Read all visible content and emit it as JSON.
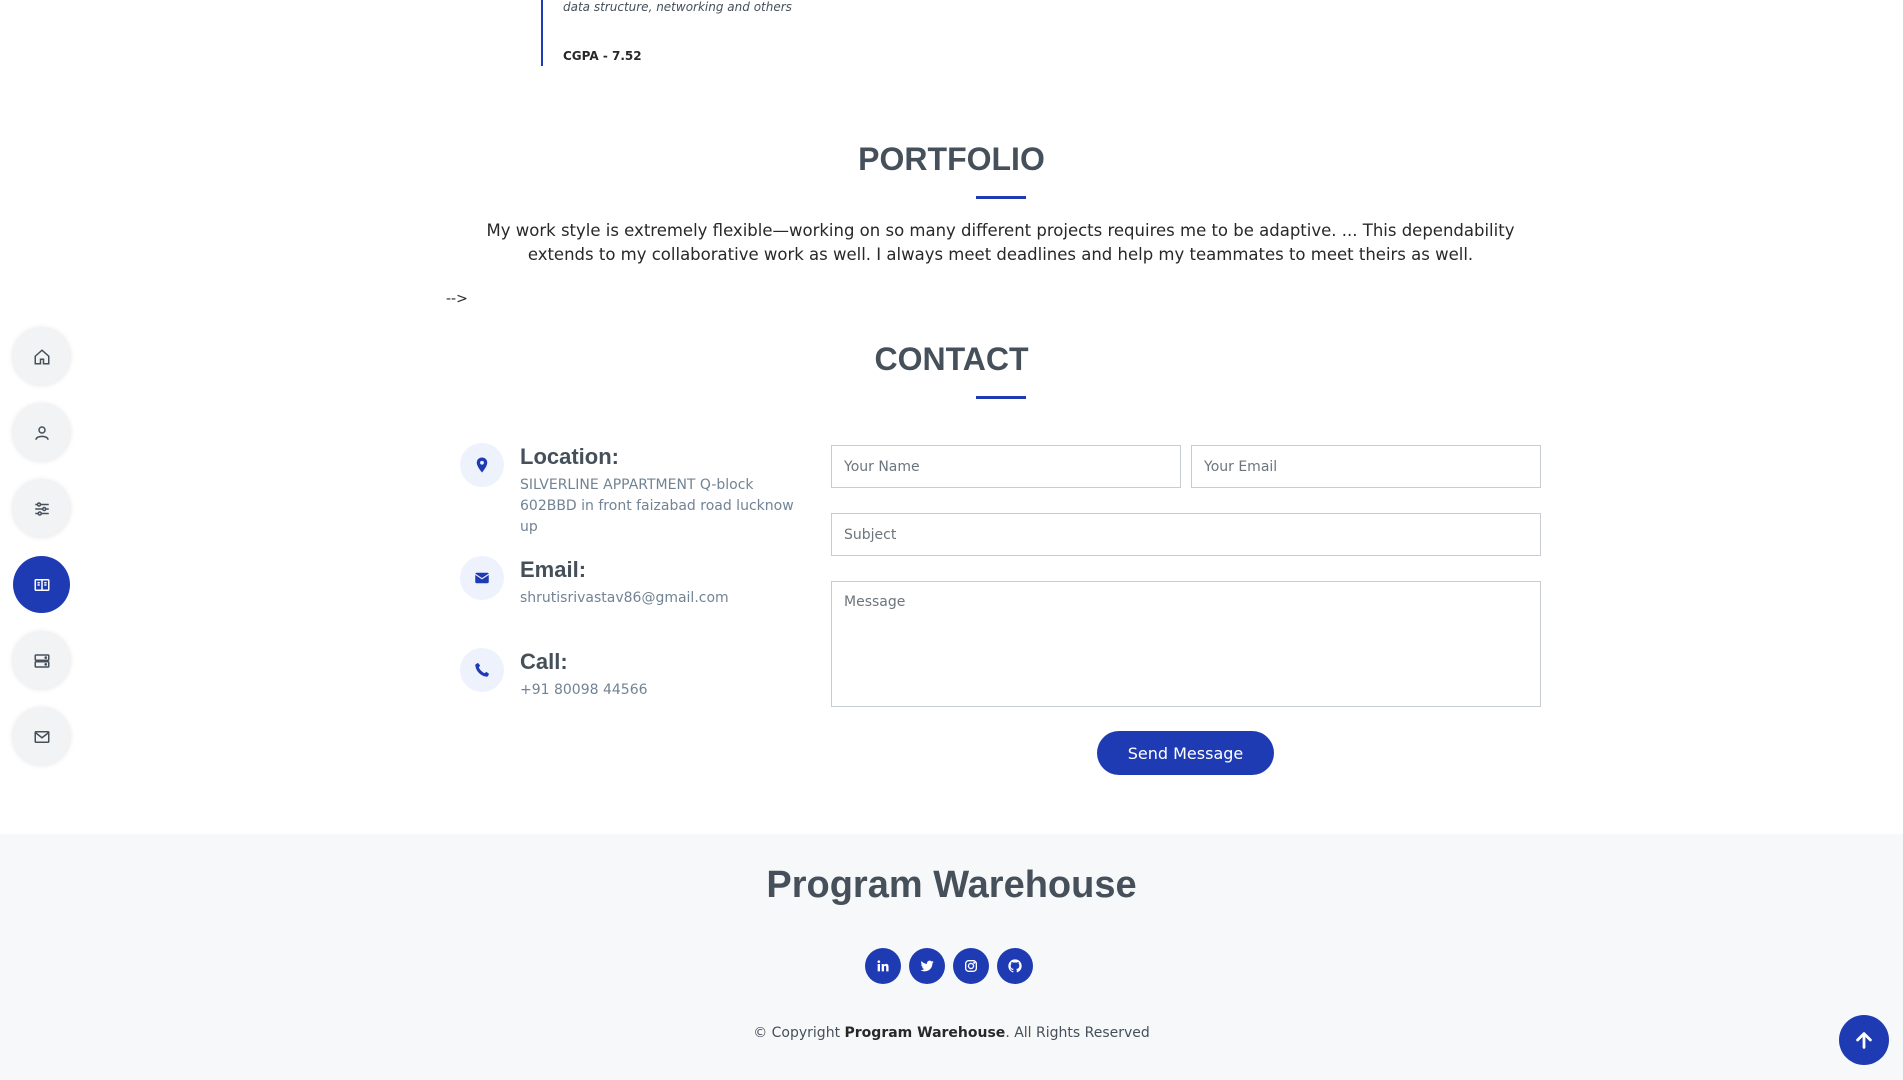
{
  "resume": {
    "description_tail": "data structure, networking and others",
    "cgpa": "CGPA - 7.52"
  },
  "portfolio": {
    "title": "PORTFOLIO",
    "text": "My work style is extremely flexible—working on so many different projects requires me to be adaptive. ... This dependability extends to my collaborative work as well. I always meet deadlines and help my teammates to meet theirs as well.",
    "stray_text": "-->"
  },
  "contact": {
    "title": "CONTACT",
    "location": {
      "heading": "Location:",
      "value": "SILVERLINE APPARTMENT Q-block 602BBD in front faizabad road lucknow up",
      "icon": "map-pin-icon"
    },
    "email": {
      "heading": "Email:",
      "value": "shrutisrivastav86@gmail.com",
      "icon": "envelope-icon"
    },
    "call": {
      "heading": "Call:",
      "value": "+91 80098 44566",
      "icon": "phone-icon"
    },
    "form": {
      "name_placeholder": "Your Name",
      "email_placeholder": "Your Email",
      "subject_placeholder": "Subject",
      "message_placeholder": "Message",
      "send_label": "Send Message"
    }
  },
  "nav": [
    {
      "icon": "home-icon",
      "active": false
    },
    {
      "icon": "person-icon",
      "active": false
    },
    {
      "icon": "sliders-icon",
      "active": false
    },
    {
      "icon": "book-icon",
      "active": true
    },
    {
      "icon": "server-icon",
      "active": false
    },
    {
      "icon": "envelope-icon",
      "active": false
    }
  ],
  "footer": {
    "title": "Program Warehouse",
    "social": [
      "linkedin-icon",
      "twitter-icon",
      "instagram-icon",
      "github-icon"
    ],
    "copyright_prefix": "© Copyright ",
    "copyright_brand": "Program Warehouse",
    "copyright_suffix": ". All Rights Reserved"
  },
  "colors": {
    "accent": "#1f3bb3",
    "heading": "#45505b",
    "muted": "#728394",
    "footer_bg": "#f7f8f9"
  }
}
